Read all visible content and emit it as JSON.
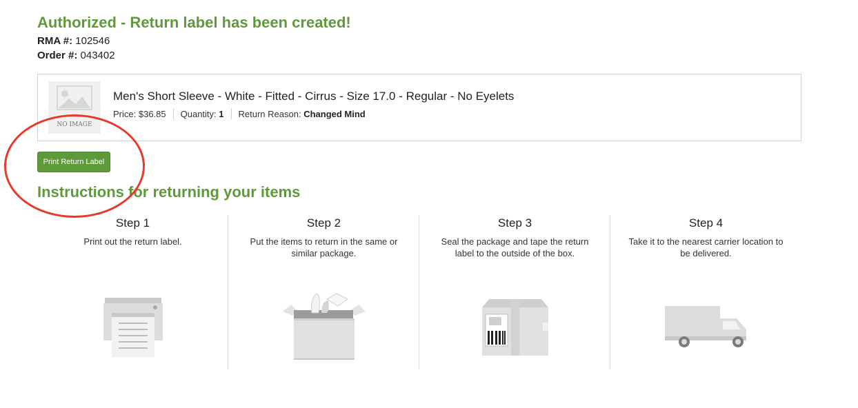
{
  "header": {
    "title": "Authorized - Return label has been created!",
    "rma_label": "RMA #:",
    "rma_value": "102546",
    "order_label": "Order #:",
    "order_value": "043402"
  },
  "item": {
    "thumbnail_text": "NO IMAGE",
    "name": "Men's Short Sleeve - White - Fitted - Cirrus - Size 17.0 - Regular - No Eyelets",
    "price_label": "Price:",
    "price_value": "$36.85",
    "quantity_label": "Quantity:",
    "quantity_value": "1",
    "reason_label": "Return Reason:",
    "reason_value": "Changed Mind"
  },
  "actions": {
    "print_label": "Print Return Label"
  },
  "instructions": {
    "title": "Instructions for returning your items",
    "steps": [
      {
        "title": "Step 1",
        "description": "Print out the return label.",
        "icon": "printer-icon"
      },
      {
        "title": "Step 2",
        "description": "Put the items to return in the same or similar package.",
        "icon": "open-box-icon"
      },
      {
        "title": "Step 3",
        "description": "Seal the package and tape the return label to the outside of the box.",
        "icon": "sealed-box-icon"
      },
      {
        "title": "Step 4",
        "description": "Take it to the nearest carrier location to be delivered.",
        "icon": "truck-icon"
      }
    ]
  },
  "colors": {
    "accent_green": "#5f9a3a",
    "annotation_red": "#e8392a",
    "border_gray": "#cfcfcf"
  }
}
